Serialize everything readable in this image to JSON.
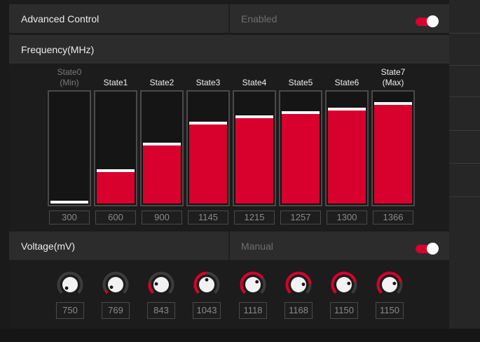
{
  "advanced_control": {
    "label": "Advanced Control",
    "status": "Enabled",
    "enabled": true
  },
  "frequency": {
    "label": "Frequency(MHz)",
    "scale_min": 300,
    "scale_max": 1366,
    "states": [
      {
        "name": "State0",
        "sub": "(Min)",
        "value": "300",
        "dim": true
      },
      {
        "name": "State1",
        "sub": "",
        "value": "600",
        "dim": false
      },
      {
        "name": "State2",
        "sub": "",
        "value": "900",
        "dim": false
      },
      {
        "name": "State3",
        "sub": "",
        "value": "1145",
        "dim": false
      },
      {
        "name": "State4",
        "sub": "",
        "value": "1215",
        "dim": false
      },
      {
        "name": "State5",
        "sub": "",
        "value": "1257",
        "dim": false
      },
      {
        "name": "State6",
        "sub": "",
        "value": "1300",
        "dim": false
      },
      {
        "name": "State7",
        "sub": "(Max)",
        "value": "1366",
        "dim": false
      }
    ]
  },
  "voltage": {
    "label": "Voltage(mV)",
    "status": "Manual",
    "enabled": true,
    "values": [
      "750",
      "769",
      "843",
      "1043",
      "1118",
      "1168",
      "1150",
      "1150"
    ],
    "knob_levels": [
      0.0,
      0.05,
      0.2,
      0.5,
      0.7,
      0.82,
      0.78,
      0.78
    ]
  },
  "colors": {
    "accent": "#d8002c",
    "indicator": "#ffffff"
  }
}
